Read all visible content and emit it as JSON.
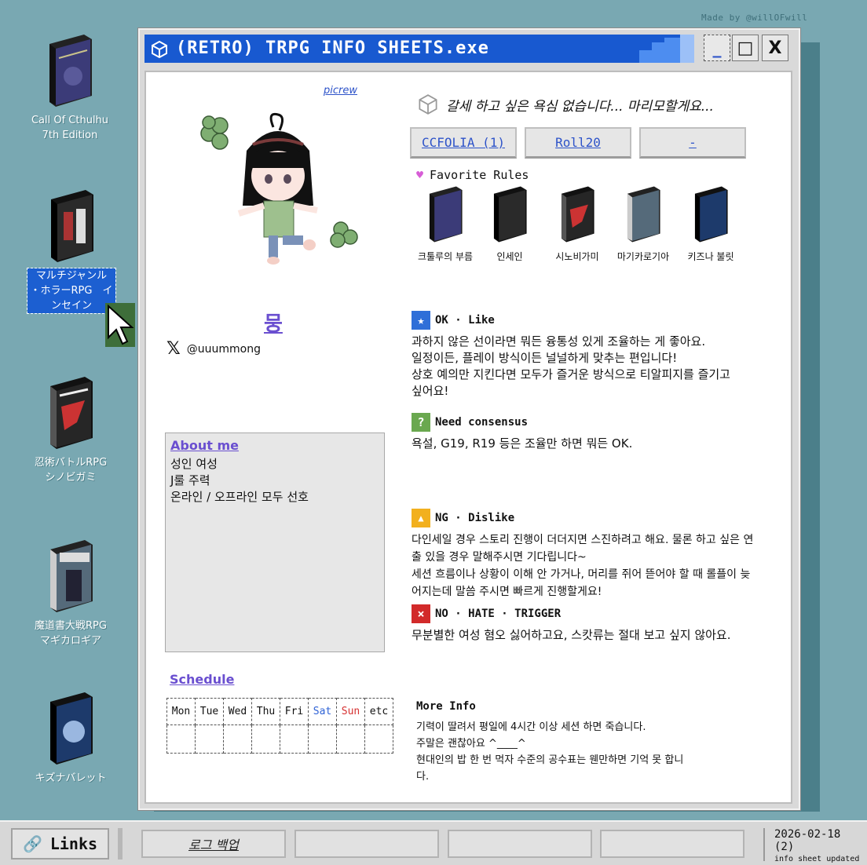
{
  "credit": "Made by @willOFwill",
  "desktop_icons": [
    {
      "label": "Call Of Cthulhu\n7th Edition",
      "cover": "#3b3b78",
      "spine": "#2b2b2b"
    },
    {
      "label": "マルチジャンル\n・ホラーRPG　イ\nンセイン",
      "cover": "#2a2a2a",
      "spine": "#1a1a1a",
      "selected": true
    },
    {
      "label": "忍術バトルRPG\nシノビガミ",
      "cover": "#262626",
      "spine": "#444"
    },
    {
      "label": "魔道書大戦RPG\nマギカロギア",
      "cover": "#556a7a",
      "spine": "#334"
    },
    {
      "label": "キズナバレット",
      "cover": "#1d3a6b",
      "spine": "#123"
    }
  ],
  "window": {
    "title": "(RETRO) TRPG INFO SHEETS.exe",
    "btn_min": "_",
    "btn_max": "□",
    "btn_close": "X"
  },
  "profile": {
    "picrew": "picrew",
    "name": "뭉",
    "handle": "@uuummong",
    "about_title": "About me",
    "about_lines": [
      "성인 여성",
      "J룰 주력",
      "온라인 / 오프라인 모두 선호"
    ]
  },
  "schedule": {
    "title": "Schedule",
    "days": [
      "Mon",
      "Tue",
      "Wed",
      "Thu",
      "Fri",
      "Sat",
      "Sun",
      "etc"
    ]
  },
  "quote": "갈세 하고 싶은 욕심 없습니다... 마리모할게요...",
  "links": [
    "CCFOLIA (1)",
    "Roll20",
    "-"
  ],
  "favorites": {
    "title": "Favorite Rules",
    "items": [
      {
        "label": "크툴루의 부름",
        "cover": "#3b3b78"
      },
      {
        "label": "인세인",
        "cover": "#2a2a2a"
      },
      {
        "label": "시노비가미",
        "cover": "#262626"
      },
      {
        "label": "마기카로기아",
        "cover": "#556a7a"
      },
      {
        "label": "키즈나 불릿",
        "cover": "#1d3a6b"
      }
    ]
  },
  "sections": [
    {
      "title": "OK · Like",
      "badge": "★",
      "color": "#2f6fd8",
      "body": "과하지 않은 선이라면 뭐든 융통성 있게 조율하는 게 좋아요.\n일정이든, 플레이 방식이든 널널하게 맞추는 편입니다!\n상호 예의만 지킨다면 모두가 즐거운 방식으로 티알피지를 즐기고\n싶어요!"
    },
    {
      "title": "Need consensus",
      "badge": "?",
      "color": "#6aa84f",
      "body": "욕설, G19, R19 등은 조율만 하면 뭐든 OK."
    },
    {
      "title": "NG · Dislike",
      "badge": "▲",
      "color": "#f2b01e",
      "body": "다인세일 경우 스토리 진행이 더더지면 스진하려고 해요. 물론 하고 싶은 연\n출 있을 경우 말해주시면 기다립니다~\n세션 흐름이나 상황이 이해 안 가거나, 머리를 쥐어 뜯어야 할 때 롤플이 늦\n어지는데 말씀 주시면 빠르게 진행할게요!"
    },
    {
      "title": "NO · HATE · TRIGGER",
      "badge": "×",
      "color": "#d22a2a",
      "body": "무분별한 여성 혐오 싫어하고요, 스캇류는 절대 보고 싶지 않아요."
    }
  ],
  "more_info": {
    "title": "More Info",
    "body": "기력이 딸려서 평일에 4시간 이상 세션 하면 죽습니다.\n주말은 괜찮아요 ^____^\n현대인의 밥 한 번 먹자 수준의 공수표는 웬만하면 기억 못 합니\n다."
  },
  "taskbar": {
    "start_label": "Links",
    "buttons": [
      "로그 백업",
      "",
      "",
      ""
    ],
    "date": "2026-02-18 (2)",
    "status": "info sheet updated"
  }
}
